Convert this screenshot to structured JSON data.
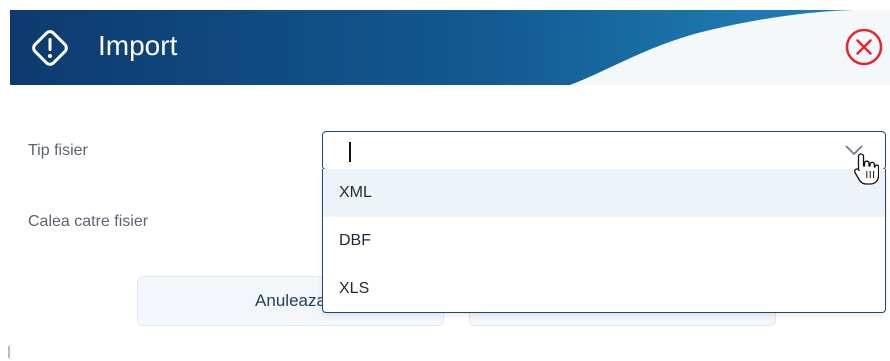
{
  "dialog": {
    "title": "Import",
    "header_icon": "warning-diamond-icon",
    "close_icon": "close-circle-icon"
  },
  "form": {
    "file_type_label": "Tip fisier",
    "file_path_label": "Calea catre fisier",
    "file_type_select": {
      "value": "",
      "open": true,
      "options": [
        "XML",
        "DBF",
        "XLS"
      ]
    }
  },
  "buttons": {
    "cancel_label": "Anuleaza"
  },
  "colors": {
    "header_dark": "#0d3a6e",
    "header_mid": "#15639c",
    "close_red": "#e5262f",
    "border": "#1a4a7a",
    "label": "#5b6470"
  }
}
